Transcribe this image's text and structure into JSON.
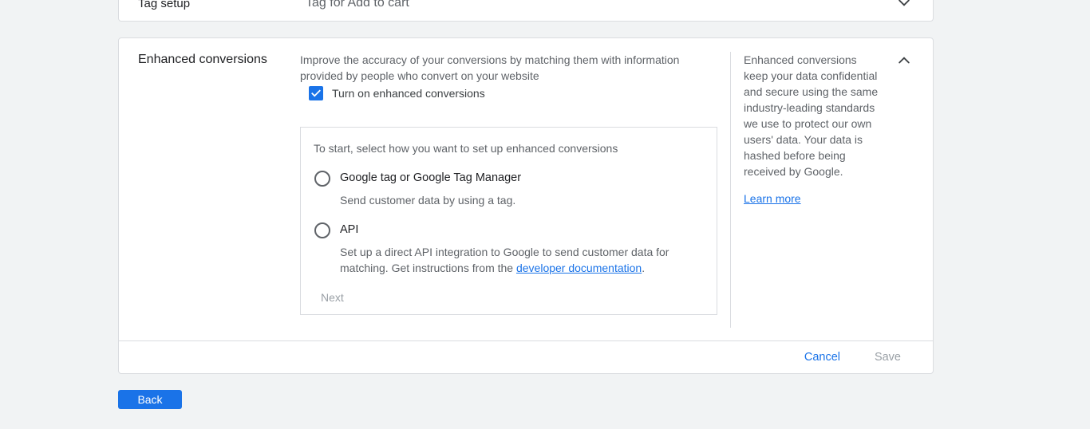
{
  "tag_setup": {
    "title": "Tag setup",
    "value": "Tag for Add to cart"
  },
  "enhanced": {
    "title": "Enhanced conversions",
    "intro": "Improve the accuracy of your conversions by matching them with information provided by people who convert on your website",
    "checkbox_label": "Turn on enhanced conversions",
    "checkbox_checked": true,
    "setup_intro": "To start, select how you want to set up enhanced conversions",
    "options": [
      {
        "label": "Google tag or Google Tag Manager",
        "desc": "Send customer data by using a tag."
      },
      {
        "label": "API",
        "desc_prefix": "Set up a direct API integration to Google to send customer data for matching. Get instructions from the ",
        "desc_link": "developer documentation",
        "desc_suffix": "."
      }
    ],
    "next_label": "Next",
    "side_help": "Enhanced conversions keep your data confidential and secure using the same industry-leading standards we use to protect our own users' data. Your data is hashed before being received by Google.",
    "learn_more": "Learn more",
    "cancel_label": "Cancel",
    "save_label": "Save"
  },
  "footer": {
    "back_label": "Back"
  },
  "colors": {
    "accent": "#1a73e8",
    "disabled": "#9aa0a6"
  }
}
